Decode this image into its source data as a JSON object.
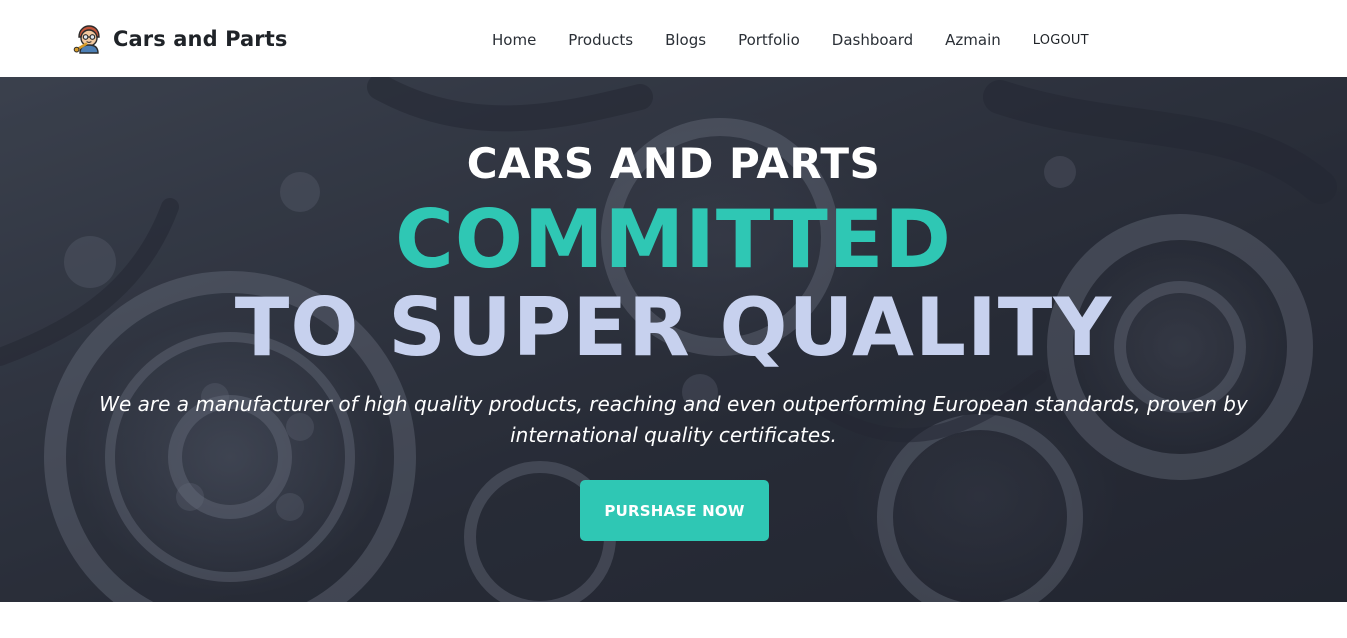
{
  "brand": {
    "name": "Cars and Parts",
    "logo_icon": "mechanic-avatar-icon"
  },
  "nav": {
    "items": [
      {
        "label": "Home"
      },
      {
        "label": "Products"
      },
      {
        "label": "Blogs"
      },
      {
        "label": "Portfolio"
      },
      {
        "label": "Dashboard"
      },
      {
        "label": "Azmain"
      },
      {
        "label": "LOGOUT"
      }
    ]
  },
  "hero": {
    "kicker": "CARS AND PARTS",
    "title_line1": "COMMITTED",
    "title_line2": "TO SUPER QUALITY",
    "description": "We are a manufacturer of high quality products, reaching and even outperforming European standards, proven by international quality certificates.",
    "cta_label": "PURSHASE NOW",
    "background": "car-engine-photo"
  },
  "colors": {
    "accent": "#2fc7b4",
    "title_light": "#c7d1ee",
    "nav_text": "#2a2f36",
    "brand_text": "#1f2328"
  }
}
